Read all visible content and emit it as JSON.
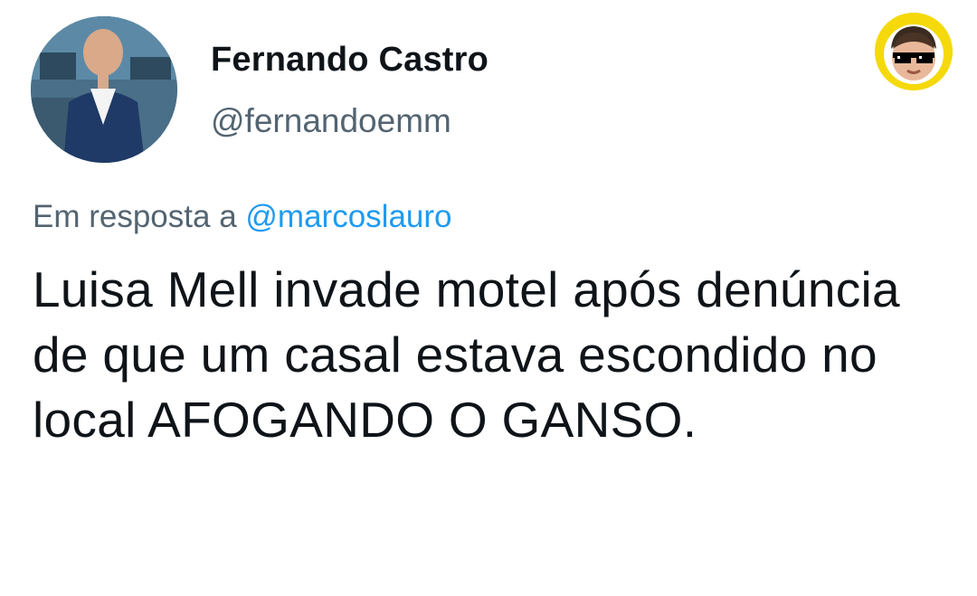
{
  "author": {
    "display_name": "Fernando Castro",
    "handle": "@fernandoemm"
  },
  "reply_context": {
    "prefix": "Em resposta a",
    "mention": "@marcoslauro"
  },
  "tweet": {
    "text": "Luisa Mell invade motel após denúncia de que um casal estava escondido no local AFOGANDO O GANSO."
  },
  "colors": {
    "secondary_text": "#536471",
    "link": "#1d9bf0",
    "primary_text": "#0f1419",
    "badge_bg": "#f5d90a"
  },
  "icons": {
    "avatar": "avatar-photo",
    "top_right_badge": "sunglasses-baby-emoji"
  }
}
